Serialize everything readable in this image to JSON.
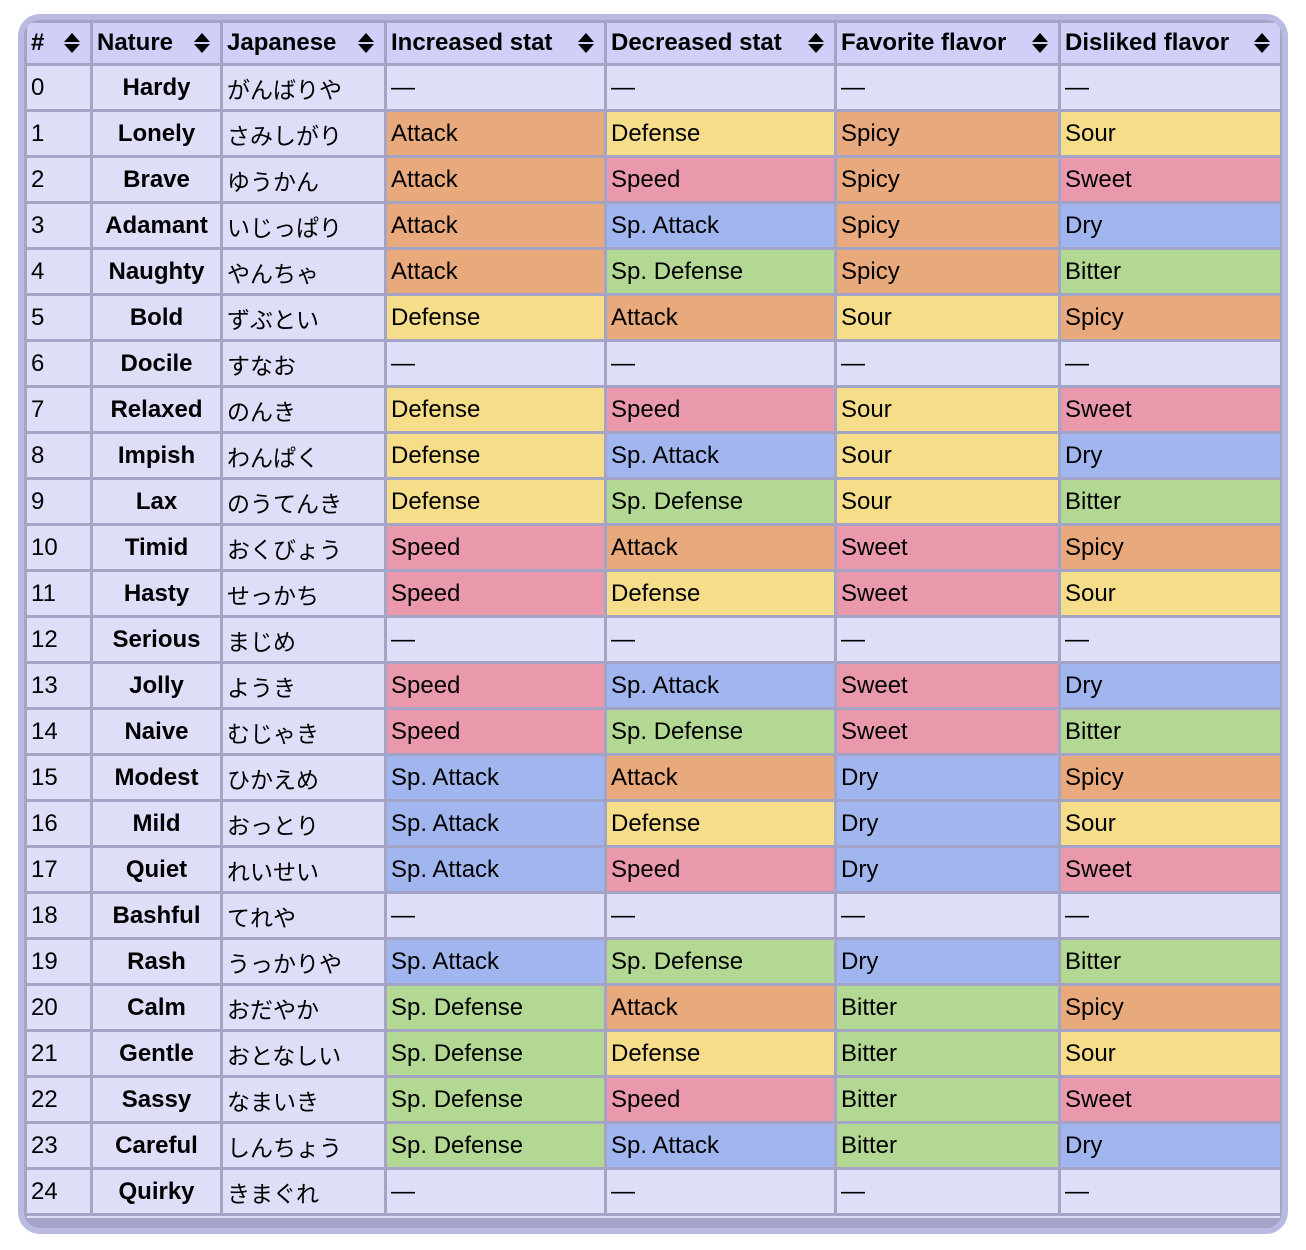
{
  "table": {
    "columns": [
      {
        "label": "#",
        "sortable": true
      },
      {
        "label": "Nature",
        "sortable": true
      },
      {
        "label": "Japanese",
        "sortable": true
      },
      {
        "label": "Increased stat",
        "sortable": true
      },
      {
        "label": "Decreased stat",
        "sortable": true
      },
      {
        "label": "Favorite flavor",
        "sortable": true
      },
      {
        "label": "Disliked flavor",
        "sortable": true
      }
    ],
    "sort_icon": "sort-up-down-icon",
    "rows": [
      {
        "num": "0",
        "nature": "Hardy",
        "japanese": "がんばりや",
        "increased": "—",
        "decreased": "—",
        "favorite": "—",
        "disliked": "—"
      },
      {
        "num": "1",
        "nature": "Lonely",
        "japanese": "さみしがり",
        "increased": "Attack",
        "decreased": "Defense",
        "favorite": "Spicy",
        "disliked": "Sour"
      },
      {
        "num": "2",
        "nature": "Brave",
        "japanese": "ゆうかん",
        "increased": "Attack",
        "decreased": "Speed",
        "favorite": "Spicy",
        "disliked": "Sweet"
      },
      {
        "num": "3",
        "nature": "Adamant",
        "japanese": "いじっぱり",
        "increased": "Attack",
        "decreased": "Sp. Attack",
        "favorite": "Spicy",
        "disliked": "Dry"
      },
      {
        "num": "4",
        "nature": "Naughty",
        "japanese": "やんちゃ",
        "increased": "Attack",
        "decreased": "Sp. Defense",
        "favorite": "Spicy",
        "disliked": "Bitter"
      },
      {
        "num": "5",
        "nature": "Bold",
        "japanese": "ずぶとい",
        "increased": "Defense",
        "decreased": "Attack",
        "favorite": "Sour",
        "disliked": "Spicy"
      },
      {
        "num": "6",
        "nature": "Docile",
        "japanese": "すなお",
        "increased": "—",
        "decreased": "—",
        "favorite": "—",
        "disliked": "—"
      },
      {
        "num": "7",
        "nature": "Relaxed",
        "japanese": "のんき",
        "increased": "Defense",
        "decreased": "Speed",
        "favorite": "Sour",
        "disliked": "Sweet"
      },
      {
        "num": "8",
        "nature": "Impish",
        "japanese": "わんぱく",
        "increased": "Defense",
        "decreased": "Sp. Attack",
        "favorite": "Sour",
        "disliked": "Dry"
      },
      {
        "num": "9",
        "nature": "Lax",
        "japanese": "のうてんき",
        "increased": "Defense",
        "decreased": "Sp. Defense",
        "favorite": "Sour",
        "disliked": "Bitter"
      },
      {
        "num": "10",
        "nature": "Timid",
        "japanese": "おくびょう",
        "increased": "Speed",
        "decreased": "Attack",
        "favorite": "Sweet",
        "disliked": "Spicy"
      },
      {
        "num": "11",
        "nature": "Hasty",
        "japanese": "せっかち",
        "increased": "Speed",
        "decreased": "Defense",
        "favorite": "Sweet",
        "disliked": "Sour"
      },
      {
        "num": "12",
        "nature": "Serious",
        "japanese": "まじめ",
        "increased": "—",
        "decreased": "—",
        "favorite": "—",
        "disliked": "—"
      },
      {
        "num": "13",
        "nature": "Jolly",
        "japanese": "ようき",
        "increased": "Speed",
        "decreased": "Sp. Attack",
        "favorite": "Sweet",
        "disliked": "Dry"
      },
      {
        "num": "14",
        "nature": "Naive",
        "japanese": "むじゃき",
        "increased": "Speed",
        "decreased": "Sp. Defense",
        "favorite": "Sweet",
        "disliked": "Bitter"
      },
      {
        "num": "15",
        "nature": "Modest",
        "japanese": "ひかえめ",
        "increased": "Sp. Attack",
        "decreased": "Attack",
        "favorite": "Dry",
        "disliked": "Spicy"
      },
      {
        "num": "16",
        "nature": "Mild",
        "japanese": "おっとり",
        "increased": "Sp. Attack",
        "decreased": "Defense",
        "favorite": "Dry",
        "disliked": "Sour"
      },
      {
        "num": "17",
        "nature": "Quiet",
        "japanese": "れいせい",
        "increased": "Sp. Attack",
        "decreased": "Speed",
        "favorite": "Dry",
        "disliked": "Sweet"
      },
      {
        "num": "18",
        "nature": "Bashful",
        "japanese": "てれや",
        "increased": "—",
        "decreased": "—",
        "favorite": "—",
        "disliked": "—"
      },
      {
        "num": "19",
        "nature": "Rash",
        "japanese": "うっかりや",
        "increased": "Sp. Attack",
        "decreased": "Sp. Defense",
        "favorite": "Dry",
        "disliked": "Bitter"
      },
      {
        "num": "20",
        "nature": "Calm",
        "japanese": "おだやか",
        "increased": "Sp. Defense",
        "decreased": "Attack",
        "favorite": "Bitter",
        "disliked": "Spicy"
      },
      {
        "num": "21",
        "nature": "Gentle",
        "japanese": "おとなしい",
        "increased": "Sp. Defense",
        "decreased": "Defense",
        "favorite": "Bitter",
        "disliked": "Sour"
      },
      {
        "num": "22",
        "nature": "Sassy",
        "japanese": "なまいき",
        "increased": "Sp. Defense",
        "decreased": "Speed",
        "favorite": "Bitter",
        "disliked": "Sweet"
      },
      {
        "num": "23",
        "nature": "Careful",
        "japanese": "しんちょう",
        "increased": "Sp. Defense",
        "decreased": "Sp. Attack",
        "favorite": "Bitter",
        "disliked": "Dry"
      },
      {
        "num": "24",
        "nature": "Quirky",
        "japanese": "きまぐれ",
        "increased": "—",
        "decreased": "—",
        "favorite": "—",
        "disliked": "—"
      }
    ]
  },
  "colors": {
    "attack_spicy": "#e8a97c",
    "defense_sour": "#f5dd8a",
    "speed_sweet": "#ea99ad",
    "spattack_dry": "#a1b6ee",
    "spdefense_bitter": "#b3d894",
    "neutral": "#dedef8",
    "header": "#cfcff8",
    "frame": "#b9b9e2",
    "grid": "#a4a4c6"
  }
}
